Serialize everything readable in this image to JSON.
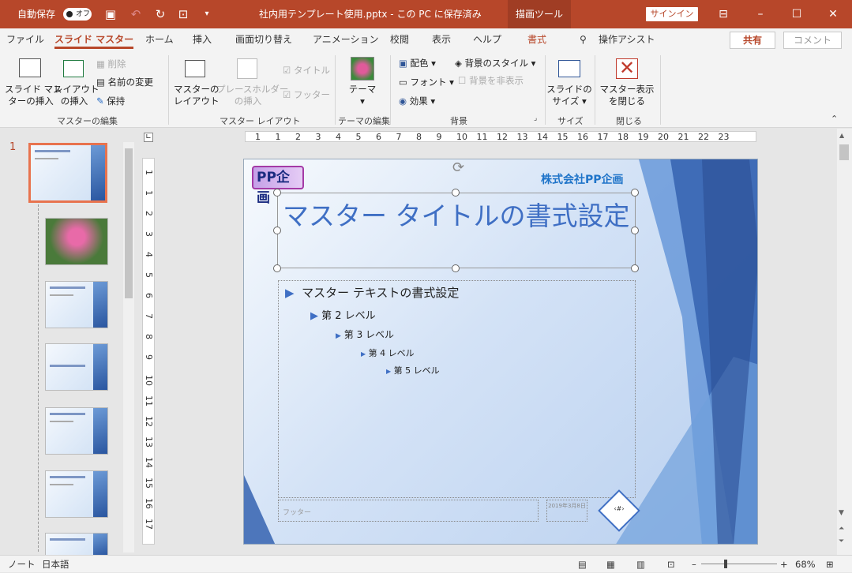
{
  "titlebar": {
    "autosave_label": "自動保存",
    "autosave_state": "オフ",
    "document_title": "社内用テンプレート使用.pptx - この PC に保存済み",
    "contextual_tab": "描画ツール",
    "signin": "サインイン"
  },
  "tabs": [
    "ファイル",
    "スライド マスター",
    "ホーム",
    "挿入",
    "画面切り替え",
    "アニメーション",
    "校閲",
    "表示",
    "ヘルプ",
    "書式"
  ],
  "tell_me": "操作アシスト",
  "share": "共有",
  "comment": "コメント",
  "ribbon": {
    "insert_master": "スライド マスターの挿入",
    "insert_master_l1": "スライド マス",
    "insert_master_l2": "ターの挿入",
    "insert_layout_l1": "レイアウト",
    "insert_layout_l2": "の挿入",
    "delete": "削除",
    "rename": "名前の変更",
    "preserve": "保持",
    "master_layout_l1": "マスターの",
    "master_layout_l2": "レイアウト",
    "placeholder_l1": "プレースホルダー",
    "placeholder_l2": "の挿入",
    "title_check": "タイトル",
    "footer_check": "フッター",
    "theme": "テーマ",
    "colors": "配色",
    "fonts": "フォント",
    "effects": "効果",
    "bg_styles": "背景のスタイル",
    "hide_bg": "背景を非表示",
    "slide_size_l1": "スライドの",
    "slide_size_l2": "サイズ",
    "close_l1": "マスター表示",
    "close_l2": "を閉じる",
    "group_master_edit": "マスターの編集",
    "group_master_layout": "マスター レイアウト",
    "group_theme_edit": "テーマの編集",
    "group_background": "背景",
    "group_size": "サイズ",
    "group_close": "閉じる"
  },
  "thumbnail_number": "1",
  "ruler_h": [
    "1",
    "1",
    "2",
    "3",
    "4",
    "5",
    "6",
    "7",
    "8",
    "9",
    "10",
    "11",
    "12",
    "13",
    "14",
    "15",
    "16",
    "17",
    "18",
    "19",
    "20",
    "21",
    "22",
    "23"
  ],
  "ruler_v": [
    "1",
    "1",
    "2",
    "3",
    "4",
    "5",
    "6",
    "7",
    "8",
    "9",
    "10",
    "11",
    "12",
    "13",
    "14",
    "15",
    "16",
    "17"
  ],
  "slide": {
    "logo": "PP企画",
    "company": "株式会社PP企画",
    "title": "マスター タイトルの書式設定",
    "levels": [
      "マスター テキストの書式設定",
      "第 2 レベル",
      "第 3 レベル",
      "第 4 レベル",
      "第 5 レベル"
    ],
    "footer": "フッター",
    "date": "2019年3月8日",
    "page_number": "‹#›"
  },
  "status": {
    "view": "ノート",
    "language": "日本語",
    "zoom": "68%"
  },
  "colors": {
    "accent": "#b7472a",
    "slide_blue": "#2f5597"
  }
}
